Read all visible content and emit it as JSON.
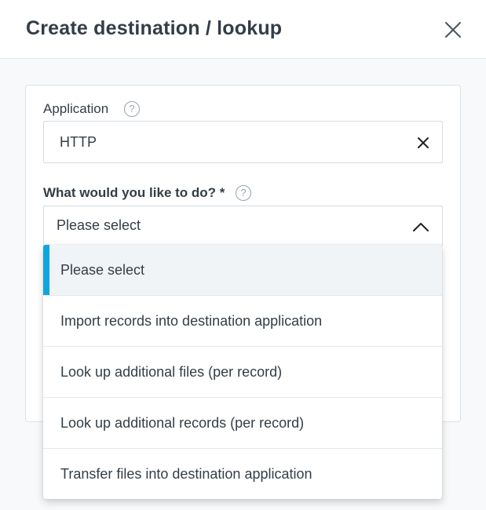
{
  "dialog": {
    "title": "Create destination / lookup",
    "close_icon": "close-icon"
  },
  "form": {
    "application": {
      "label": "Application",
      "help_glyph": "?",
      "value": "HTTP",
      "clear_icon": "clear-x-icon"
    },
    "action": {
      "label": "What would you like to do? *",
      "help_glyph": "?",
      "value": "Please select",
      "toggle_icon": "chevron-up-icon"
    }
  },
  "dropdown": {
    "options": [
      {
        "label": "Please select",
        "selected": true
      },
      {
        "label": "Import records into destination application",
        "selected": false
      },
      {
        "label": "Look up additional files (per record)",
        "selected": false
      },
      {
        "label": "Look up additional records (per record)",
        "selected": false
      },
      {
        "label": "Transfer files into destination application",
        "selected": false
      }
    ]
  },
  "colors": {
    "accent": "#0fa6e0",
    "text": "#333d47",
    "selected_bg": "#f0f4f6"
  }
}
